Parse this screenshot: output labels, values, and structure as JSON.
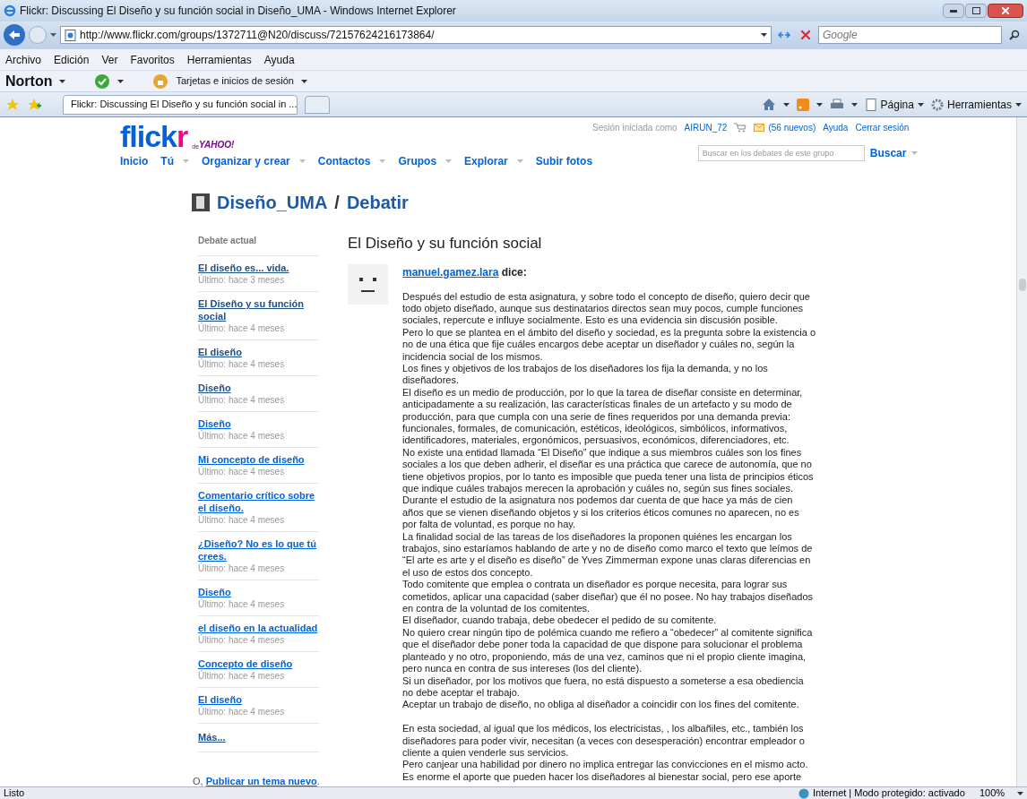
{
  "window": {
    "title": "Flickr: Discussing El Diseño y su función social in Diseño_UMA - Windows Internet Explorer"
  },
  "address_bar": {
    "url": "http://www.flickr.com/groups/1372711@N20/discuss/72157624216173864/",
    "search_placeholder": "Google"
  },
  "menu_bar": [
    "Archivo",
    "Edición",
    "Ver",
    "Favoritos",
    "Herramientas",
    "Ayuda"
  ],
  "norton_bar": {
    "brand": "Norton",
    "cards": "Tarjetas e inicios de sesión"
  },
  "tab_bar": {
    "tab": "Flickr: Discussing El Diseño y su función social in ...",
    "tools": [
      "Página",
      "Herramientas"
    ]
  },
  "flickr_header": {
    "logo_main": "flick",
    "logo_r": "r",
    "logo_by": "de",
    "logo_yahoo": "YAHOO!",
    "signed_in_as": "Sesión iniciada como",
    "user": "AIRUN_72",
    "new_mail": "(56 nuevos)",
    "links": [
      "Ayuda",
      "Cerrar sesión"
    ],
    "nav": [
      {
        "label": "Inicio",
        "menu": false
      },
      {
        "label": "Tú",
        "menu": true
      },
      {
        "label": "Organizar y crear",
        "menu": true
      },
      {
        "label": "Contactos",
        "menu": true
      },
      {
        "label": "Grupos",
        "menu": true
      },
      {
        "label": "Explorar",
        "menu": true
      },
      {
        "label": "Subir fotos",
        "menu": false
      }
    ],
    "search_placeholder": "Buscar en los debates de este grupo",
    "search_button": "Buscar"
  },
  "breadcrumb": {
    "group": "Diseño_UMA",
    "separator": "/",
    "section": "Debatir"
  },
  "sidebar": {
    "heading": "Debate actual",
    "items": [
      {
        "title": "El diseño es... vida.",
        "meta": "Último: hace 3 meses",
        "visited": true
      },
      {
        "title": "El Diseño y su función social",
        "meta": "Último: hace 4 meses",
        "visited": true
      },
      {
        "title": "El diseño",
        "meta": "Último: hace 4 meses",
        "visited": true
      },
      {
        "title": "Diseño",
        "meta": "Último: hace 4 meses",
        "visited": true
      },
      {
        "title": "Diseño",
        "meta": "Último: hace 4 meses",
        "visited": false
      },
      {
        "title": "Mi concepto de diseño",
        "meta": "Último: hace 4 meses",
        "visited": false
      },
      {
        "title": "Comentario crítico sobre el diseño.",
        "meta": "Último: hace 4 meses",
        "visited": false
      },
      {
        "title": "¿Diseño? No es lo que tú crees.",
        "meta": "Último: hace 4 meses",
        "visited": false
      },
      {
        "title": "Diseño",
        "meta": "Último: hace 4 meses",
        "visited": false
      },
      {
        "title": "el diseño en la actualidad",
        "meta": "Último: hace 4 meses",
        "visited": false
      },
      {
        "title": "Concepto de diseño",
        "meta": "Último: hace 4 meses",
        "visited": false
      },
      {
        "title": "El diseño",
        "meta": "Último: hace 4 meses",
        "visited": false
      }
    ],
    "more": "Más...",
    "new_topic_prefix": "O,",
    "new_topic": "Publicar un tema nuevo",
    "new_topic_suffix": "."
  },
  "post": {
    "title": "El Diseño y su función social",
    "author": "manuel.gamez.lara",
    "says": "dice:",
    "paragraphs": [
      [
        "Después del estudio de esta asignatura, y sobre todo el concepto de diseño, quiero decir que",
        "todo objeto diseñado, aunque sus destinatarios directos sean muy pocos, cumple funciones",
        "sociales, repercute e influye socialmente. Esto es una evidencia sin discusión posible.",
        "Pero lo que se plantea en el ámbito del diseño y sociedad, es la pregunta sobre la existencia o",
        "no de una ética que fije cuáles encargos debe aceptar un diseñador y cuáles no, según la",
        "incidencia social de los mismos.",
        "Los fines y objetivos de los trabajos de los diseñadores los fija la demanda, y no los",
        "diseñadores.",
        "El diseño es un medio de producción, por lo que la tarea de diseñar consiste en determinar,",
        "anticipadamente a su realización, las características finales de un artefacto y su modo de",
        "producción, para que cumpla con una serie de fines requeridos por una demanda previa:",
        "funcionales, formales, de comunicación, estéticos, ideológicos, simbólicos, informativos,",
        "identificadores, materiales, ergonómicos, persuasivos, económicos, diferenciadores, etc.",
        "No existe una entidad llamada “El Diseño” que indique a sus miembros cuáles son los fines",
        "sociales a los que deben adherir, el diseñar es una práctica que carece de autonomía, que no",
        "tiene objetivos propios, por lo tanto es imposible que pueda tener una lista de principios éticos",
        "que indique cuáles trabajos merecen la aprobación y cuáles no, según sus fines sociales.",
        "Durante el estudio de la asignatura nos podemos dar cuenta de que hace ya más de cien",
        "años que se vienen diseñando objetos y si los criterios éticos comunes no aparecen, no es",
        "por falta de voluntad, es porque no hay.",
        "La finalidad social de las tareas de los diseñadores la proponen quiénes les encargan los",
        "trabajos, sino estaríamos hablando de arte y no de diseño como marco el texto que leímos de",
        "“El arte es arte y el diseño es diseño” de Yves Zimmerman expone unas claras diferencias en",
        "el uso de estos dos concepto.",
        "Todo comitente que emplea o contrata un diseñador es porque necesita, para lograr sus",
        "cometidos, aplicar una capacidad (saber diseñar) que él no posee. No hay trabajos diseñados",
        "en contra de la voluntad de los comitentes.",
        "El diseñador, cuando trabaja, debe obedecer el pedido de su comitente.",
        "No quiero crear ningún tipo de polémica cuando me refiero a “obedecer” al comitente significa",
        "que el diseñador debe poner toda la capacidad de que dispone para solucionar el problema",
        "planteado y no otro, proponiendo, más de una vez, caminos que ni el propio cliente imagina,",
        "pero nunca en contra de sus intereses (los del cliente).",
        "Si un diseñador, por los motivos que fuera, no está dispuesto a someterse a esa obediencia",
        "no debe aceptar el trabajo.",
        "Aceptar un trabajo de diseño, no obliga al diseñador a coincidir con los fines del comitente."
      ],
      [
        "En esta sociedad, al igual que los médicos, los electricistas, , los albañiles, etc., también los",
        "diseñadores para poder vivir, necesitan (a veces con desesperación) encontrar empleador o",
        "cliente a quien venderle sus servicios.",
        "Pero canjear una habilidad por dinero no implica entregar las convicciones en el mismo acto.",
        "Es enorme el aporte que pueden hacer los diseñadores al bienestar social, pero ese aporte"
      ]
    ]
  },
  "status_bar": {
    "text": "Listo",
    "zone": "Internet | Modo protegido: activado",
    "zoom": "100%"
  }
}
